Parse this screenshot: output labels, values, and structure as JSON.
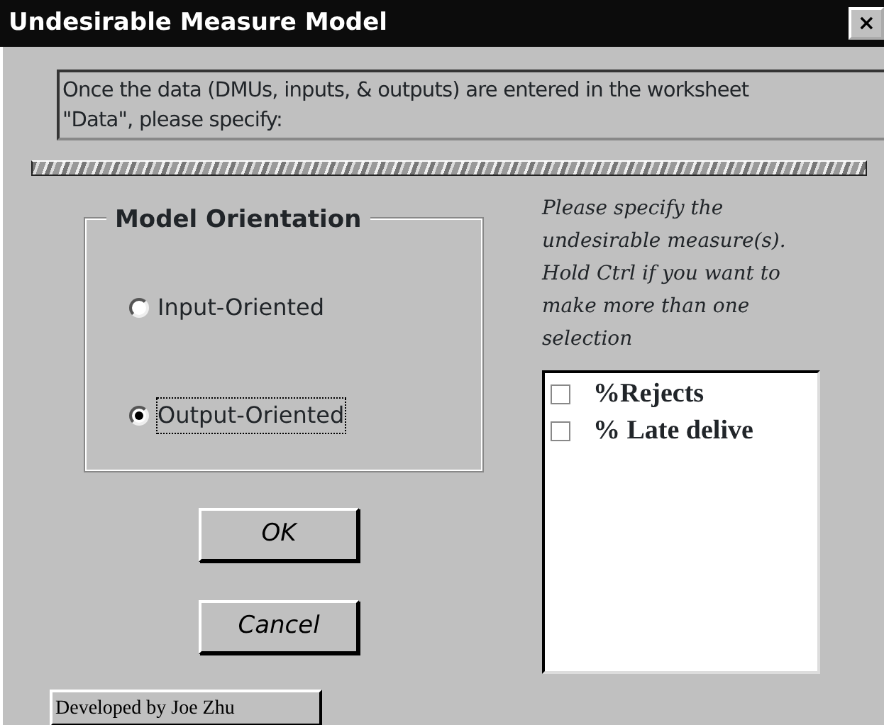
{
  "window": {
    "title": "Undesirable Measure Model",
    "close": "×"
  },
  "instructions": "Once the data (DMUs, inputs, & outputs) are entered in the worksheet \"Data\", please specify:",
  "orientation": {
    "title": "Model Orientation",
    "options": [
      {
        "label": "Input-Oriented",
        "selected": false
      },
      {
        "label": "Output-Oriented",
        "selected": true
      }
    ]
  },
  "measures": {
    "hint": "Please specify the undesirable measure(s). Hold Ctrl if you want to make more than one selection",
    "items": [
      {
        "label": "%Rejects",
        "checked": false
      },
      {
        "label": "% Late delive",
        "checked": false
      }
    ]
  },
  "buttons": [
    "OK",
    "Cancel"
  ],
  "credit": "Developed by Joe Zhu"
}
